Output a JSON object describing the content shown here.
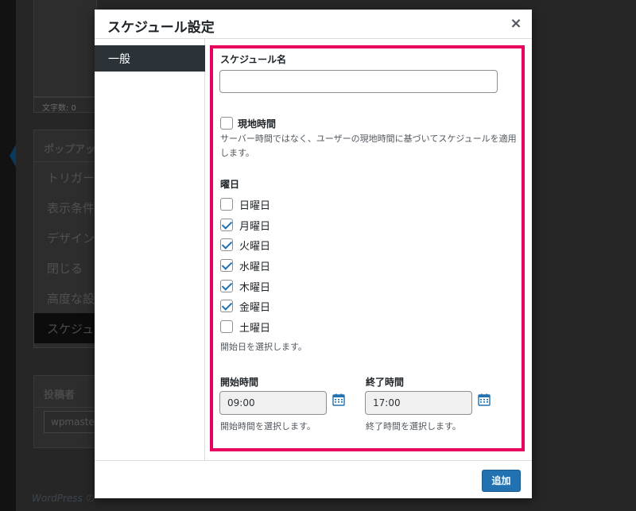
{
  "background": {
    "word_count": "文字数: 0",
    "popup_box_title": "ポップアッ",
    "menu": [
      "トリガー",
      "表示条件",
      "デザイン",
      "閉じる",
      "高度な設",
      "スケジュ"
    ],
    "author_title": "投稿者",
    "author_value": "wpmaste",
    "footer_link": "WordPress",
    "footer_tail": "の"
  },
  "modal": {
    "title": "スケジュール設定",
    "close_label": "×",
    "sidebar_tab": "一般",
    "add_button": "追加"
  },
  "form": {
    "name_label": "スケジュール名",
    "name_value": "",
    "local_time_label": "現地時間",
    "local_time_checked": false,
    "local_time_desc": "サーバー時間ではなく、ユーザーの現地時間に基づいてスケジュールを適用します。",
    "days_label": "曜日",
    "days": [
      {
        "label": "日曜日",
        "checked": false
      },
      {
        "label": "月曜日",
        "checked": true
      },
      {
        "label": "火曜日",
        "checked": true
      },
      {
        "label": "水曜日",
        "checked": true
      },
      {
        "label": "木曜日",
        "checked": true
      },
      {
        "label": "金曜日",
        "checked": true
      },
      {
        "label": "土曜日",
        "checked": false
      }
    ],
    "days_desc": "開始日を選択します。",
    "start_label": "開始時間",
    "start_value": "09:00",
    "start_desc": "開始時間を選択します。",
    "end_label": "終了時間",
    "end_value": "17:00",
    "end_desc": "終了時間を選択します。"
  },
  "colors": {
    "accent": "#2271b1",
    "highlight_border": "#e8005e",
    "sidebar_active": "#2c3338"
  },
  "icons": [
    "close-icon",
    "checkbox-icon",
    "calendar-icon"
  ]
}
